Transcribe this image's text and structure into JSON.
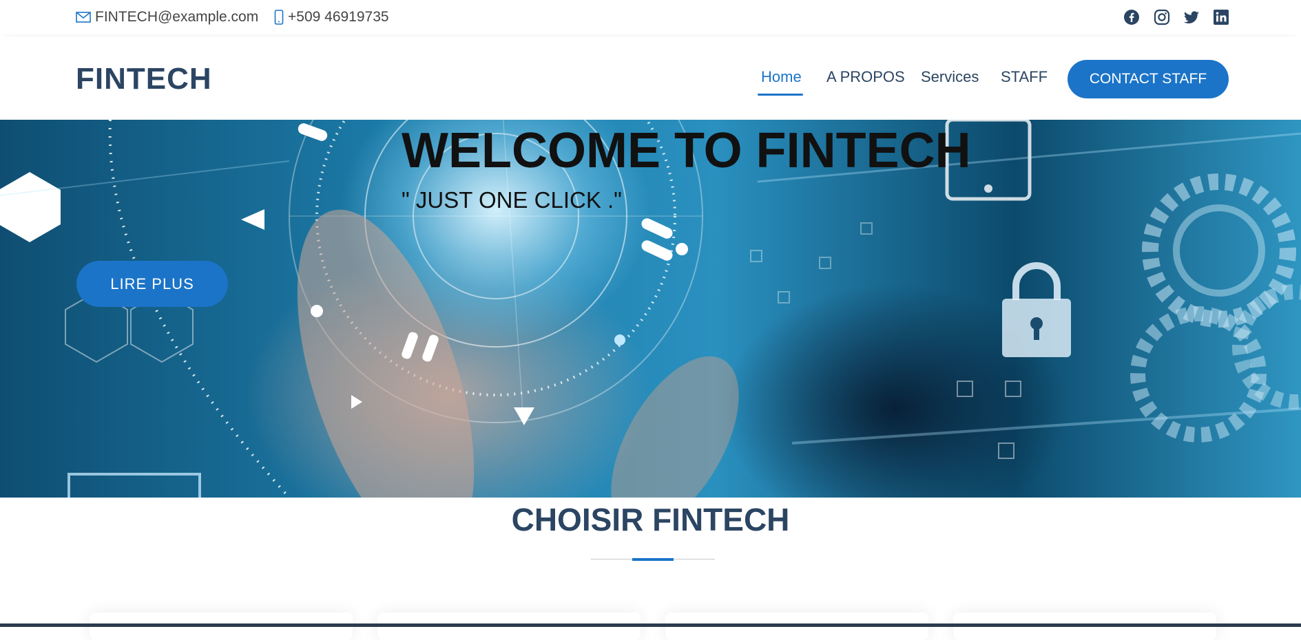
{
  "topbar": {
    "email": "FINTECH@example.com",
    "phone": "+509 46919735",
    "social_icons": [
      "facebook-icon",
      "instagram-icon",
      "twitter-icon",
      "linkedin-icon"
    ]
  },
  "header": {
    "logo": "FINTECH",
    "nav": [
      {
        "label": "Home",
        "active": true
      },
      {
        "label": "A PROPOS",
        "active": false
      },
      {
        "label": "Services",
        "active": false
      },
      {
        "label": "STAFF",
        "active": false
      }
    ],
    "cta_label": "CONTACT STAFF"
  },
  "hero": {
    "title": "WELCOME TO FINTECH",
    "subtitle": "\" JUST ONE CLICK .\"",
    "button_label": "LIRE PLUS"
  },
  "section": {
    "title": "CHOISIR FINTECH"
  },
  "colors": {
    "accent": "#1b74c8",
    "heading": "#2b4563",
    "text": "#444444"
  }
}
